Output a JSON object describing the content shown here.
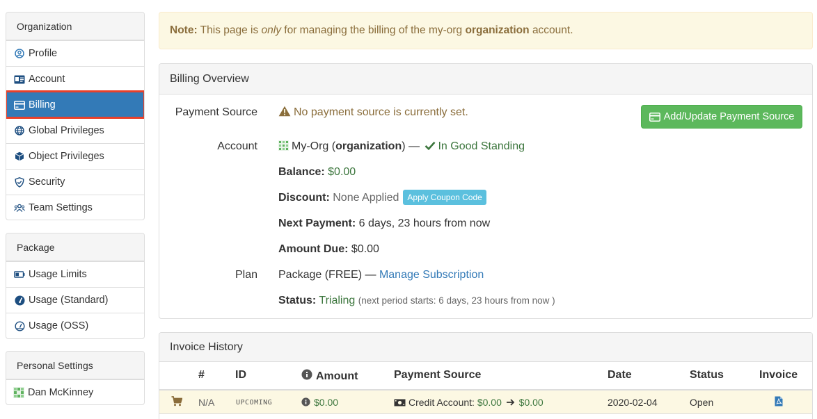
{
  "sidebar": {
    "organization": {
      "heading": "Organization",
      "items": [
        {
          "label": "Profile",
          "icon": "user-circle-icon"
        },
        {
          "label": "Account",
          "icon": "id-card-icon"
        },
        {
          "label": "Billing",
          "icon": "credit-card-icon",
          "active": true
        },
        {
          "label": "Global Privileges",
          "icon": "globe-icon"
        },
        {
          "label": "Object Privileges",
          "icon": "cube-icon"
        },
        {
          "label": "Security",
          "icon": "shield-icon"
        },
        {
          "label": "Team Settings",
          "icon": "users-icon"
        }
      ]
    },
    "package": {
      "heading": "Package",
      "items": [
        {
          "label": "Usage Limits",
          "icon": "battery-icon"
        },
        {
          "label": "Usage (Standard)",
          "icon": "gauge-filled-icon"
        },
        {
          "label": "Usage (OSS)",
          "icon": "gauge-outline-icon"
        }
      ]
    },
    "personal": {
      "heading": "Personal Settings",
      "items": [
        {
          "label": "Dan McKinney",
          "icon": "avatar-icon"
        }
      ]
    }
  },
  "note": {
    "prefix": "Note:",
    "text1": "This page is",
    "em": "only",
    "text2": "for managing the billing of the my-org",
    "strong": "organization",
    "text3": "account."
  },
  "billing": {
    "title": "Billing Overview",
    "payment_source_label": "Payment Source",
    "payment_source_value": "No payment source is currently set.",
    "add_button": "Add/Update Payment Source",
    "account_label": "Account",
    "account_name": "My-Org",
    "account_type": "organization",
    "account_dash": "—",
    "standing": "In Good Standing",
    "balance_label": "Balance:",
    "balance_value": "$0.00",
    "discount_label": "Discount:",
    "discount_value": "None Applied",
    "coupon_button": "Apply Coupon Code",
    "next_payment_label": "Next Payment:",
    "next_payment_value": "6 days, 23 hours from now",
    "amount_due_label": "Amount Due:",
    "amount_due_value": "$0.00",
    "plan_label": "Plan",
    "plan_value": "Package (FREE) —",
    "plan_link": "Manage Subscription",
    "status_label": "Status:",
    "status_value": "Trialing",
    "status_note": "(next period starts: 6 days, 23 hours from now )",
    "colors": {
      "success": "#3c763d",
      "link": "#337ab7",
      "button_green": "#5cb85c",
      "info": "#5bc0de",
      "warning_text": "#8a6d3b"
    }
  },
  "invoices": {
    "title": "Invoice History",
    "columns": [
      "#",
      "ID",
      "Amount",
      "Payment Source",
      "Date",
      "Status",
      "Invoice"
    ],
    "rows": [
      {
        "num": "N/A",
        "id": "UPCOMING",
        "amount": "$0.00",
        "source_label": "Credit Account:",
        "source_from": "$0.00",
        "source_to": "$0.00",
        "date": "2020-02-04",
        "status": "Open"
      }
    ]
  }
}
